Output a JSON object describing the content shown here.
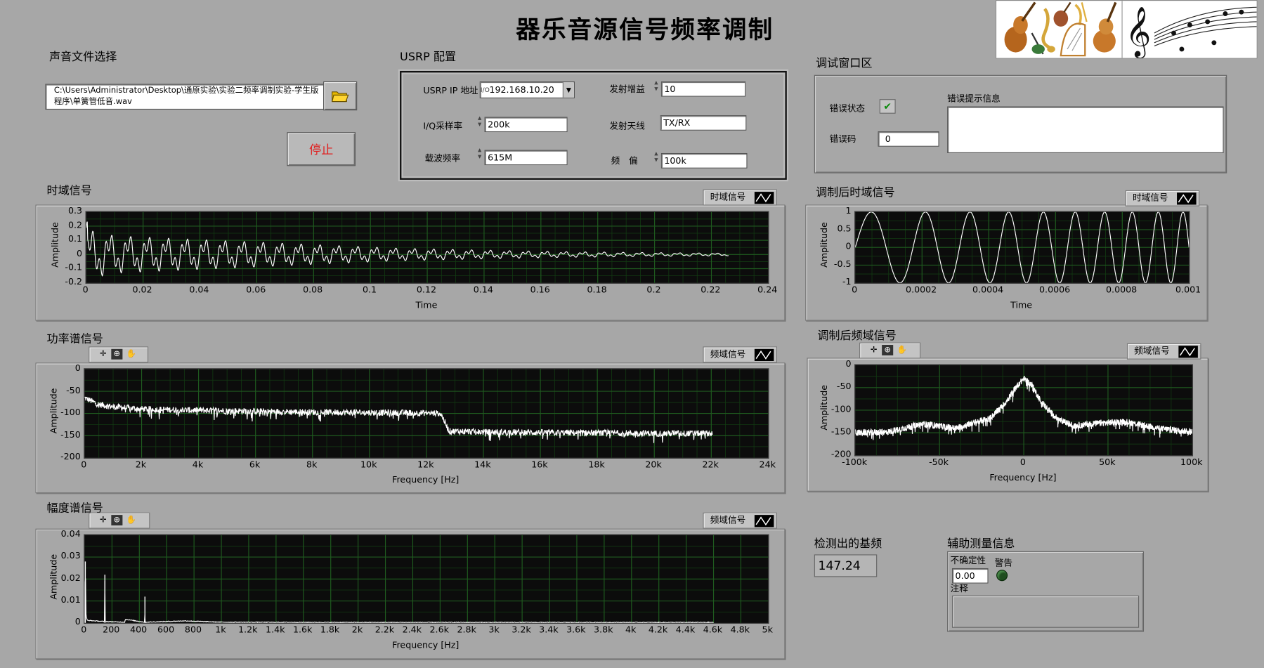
{
  "window_title": "器乐音源信号频率调制",
  "file_section": {
    "label": "声音文件选择",
    "path": "C:\\Users\\Administrator\\Desktop\\通原实验\\实验二频率调制实验-学生版程序\\单簧管低音.wav",
    "browse_icon": "folder-open-icon"
  },
  "stop_button": {
    "label": "停止",
    "color": "#e02020"
  },
  "usrp": {
    "label": "USRP 配置",
    "ip_label": "USRP IP 地址",
    "ip_value": "192.168.10.20",
    "iq_label": "I/Q采样率",
    "iq_value": "200k",
    "carrier_label": "载波频率",
    "carrier_value": "615M",
    "gain_label": "发射增益",
    "gain_value": "10",
    "antenna_label": "发射天线",
    "antenna_value": "TX/RX",
    "offset_label": "频　偏",
    "offset_value": "100k"
  },
  "debug": {
    "label": "调试窗口区",
    "status_label": "错误状态",
    "status_icon": "checkmark-icon",
    "code_label": "错误码",
    "code_value": "0",
    "msg_label": "错误提示信息",
    "msg_value": ""
  },
  "detected": {
    "label": "检测出的基频",
    "value": "147.24"
  },
  "aux": {
    "label": "辅助测量信息",
    "uncert_label": "不确定性",
    "uncert_value": "0.00",
    "warn_label": "警告",
    "note_label": "注释",
    "note_value": ""
  },
  "colors": {
    "background": "#a7a7a7",
    "plot_bg": "#0c0c0c",
    "grid": "#1f5a1f",
    "trace": "#ffffff",
    "stop_text": "#e02020"
  },
  "chart_data": [
    {
      "id": "time",
      "type": "line",
      "title": "时域信号",
      "legend": "时域信号",
      "xlabel": "Time",
      "ylabel": "Amplitude",
      "xlim": [
        0,
        0.24
      ],
      "ylim": [
        -0.2,
        0.3
      ],
      "xticks": [
        "0",
        "0.02",
        "0.04",
        "0.06",
        "0.08",
        "0.1",
        "0.12",
        "0.14",
        "0.16",
        "0.18",
        "0.2",
        "0.22",
        "0.24"
      ],
      "yticks": [
        "0.3",
        "0.2",
        "0.1",
        "0",
        "-0.1",
        "-0.2"
      ],
      "grid": true,
      "has_tools": false,
      "series": [
        {
          "x": [
            0,
            0.01,
            0.02,
            0.03,
            0.04,
            0.05,
            0.06,
            0.07,
            0.08,
            0.09,
            0.1,
            0.11,
            0.12,
            0.13,
            0.14,
            0.15,
            0.16,
            0.17,
            0.18,
            0.19,
            0.2,
            0.21,
            0.22,
            0.226
          ],
          "env": [
            0.2,
            0.15,
            0.14,
            0.13,
            0.12,
            0.11,
            0.1,
            0.09,
            0.08,
            0.07,
            0.06,
            0.05,
            0.045,
            0.04,
            0.035,
            0.03,
            0.026,
            0.022,
            0.02,
            0.017,
            0.015,
            0.013,
            0.011,
            0.01
          ],
          "center": 0.01
        }
      ]
    },
    {
      "id": "mod_time",
      "type": "line",
      "title": "调制后时域信号",
      "legend": "时域信号",
      "xlabel": "Time",
      "ylabel": "Amplitude",
      "xlim": [
        0,
        0.001
      ],
      "ylim": [
        -1,
        1
      ],
      "xticks": [
        "0",
        "0.0002",
        "0.0004",
        "0.0006",
        "0.0008",
        "0.001"
      ],
      "yticks": [
        "1",
        "0.5",
        "0",
        "-0.5",
        "-1"
      ],
      "grid": true,
      "has_tools": false,
      "series": [
        {
          "amplitude": 1,
          "start_freq": 5000,
          "end_freq": 14000
        }
      ]
    },
    {
      "id": "power",
      "type": "line",
      "title": "功率谱信号",
      "legend": "频域信号",
      "xlabel": "Frequency [Hz]",
      "ylabel": "Amplitude",
      "xlim": [
        0,
        24000
      ],
      "ylim": [
        -200,
        0
      ],
      "xticks": [
        "0",
        "2k",
        "4k",
        "6k",
        "8k",
        "10k",
        "12k",
        "14k",
        "16k",
        "18k",
        "20k",
        "22k",
        "24k"
      ],
      "yticks": [
        "0",
        "-50",
        "-100",
        "-150",
        "-200"
      ],
      "grid": true,
      "has_tools": true,
      "series": [
        {
          "x": [
            0,
            500,
            1000,
            2000,
            4000,
            6000,
            8000,
            10000,
            12000,
            12500,
            12800,
            14000,
            16000,
            18000,
            20000,
            22050
          ],
          "y": [
            -65,
            -80,
            -85,
            -90,
            -93,
            -95,
            -97,
            -98,
            -99,
            -100,
            -140,
            -142,
            -143,
            -144,
            -145,
            -145
          ]
        }
      ]
    },
    {
      "id": "mod_freq",
      "type": "line",
      "title": "调制后频域信号",
      "legend": "频域信号",
      "xlabel": "Frequency [Hz]",
      "ylabel": "Amplitude",
      "xlim": [
        -100000,
        100000
      ],
      "ylim": [
        -200,
        0
      ],
      "xticks": [
        "-100k",
        "-50k",
        "0",
        "50k",
        "100k"
      ],
      "yticks": [
        "0",
        "-50",
        "-100",
        "-150",
        "-200"
      ],
      "grid": true,
      "has_tools": true,
      "series": [
        {
          "x": [
            -100000,
            -80000,
            -60000,
            -40000,
            -30000,
            -20000,
            -10000,
            -5000,
            0,
            5000,
            10000,
            20000,
            30000,
            40000,
            60000,
            80000,
            100000
          ],
          "y": [
            -150,
            -148,
            -130,
            -140,
            -128,
            -118,
            -80,
            -50,
            -30,
            -45,
            -80,
            -120,
            -135,
            -130,
            -125,
            -140,
            -148
          ]
        }
      ]
    },
    {
      "id": "amp",
      "type": "line",
      "title": "幅度谱信号",
      "legend": "频域信号",
      "xlabel": "Frequency [Hz]",
      "ylabel": "Amplitude",
      "xlim": [
        0,
        5000
      ],
      "ylim": [
        0,
        0.04
      ],
      "xticks": [
        "0",
        "200",
        "400",
        "600",
        "800",
        "1k",
        "1.2k",
        "1.4k",
        "1.6k",
        "1.8k",
        "2k",
        "2.2k",
        "2.4k",
        "2.6k",
        "2.8k",
        "3k",
        "3.2k",
        "3.4k",
        "3.6k",
        "3.8k",
        "4k",
        "4.2k",
        "4.4k",
        "4.6k",
        "4.8k",
        "5k"
      ],
      "yticks": [
        "0.04",
        "0.03",
        "0.02",
        "0.01",
        "0"
      ],
      "grid": true,
      "has_tools": true,
      "series": [
        {
          "x": [
            0,
            5,
            10,
            20,
            147,
            148,
            150,
            295,
            296,
            440,
            441,
            443,
            735,
            1000,
            2000,
            3000,
            4000,
            4600
          ],
          "y": [
            0,
            0.028,
            0.003,
            0.001,
            0.0005,
            0.022,
            0.0005,
            0.0002,
            0.0015,
            0.0002,
            0.012,
            0.0002,
            0.0008,
            0.0002,
            0.0001,
            0.0001,
            0.0001,
            0.0001
          ]
        }
      ]
    }
  ]
}
